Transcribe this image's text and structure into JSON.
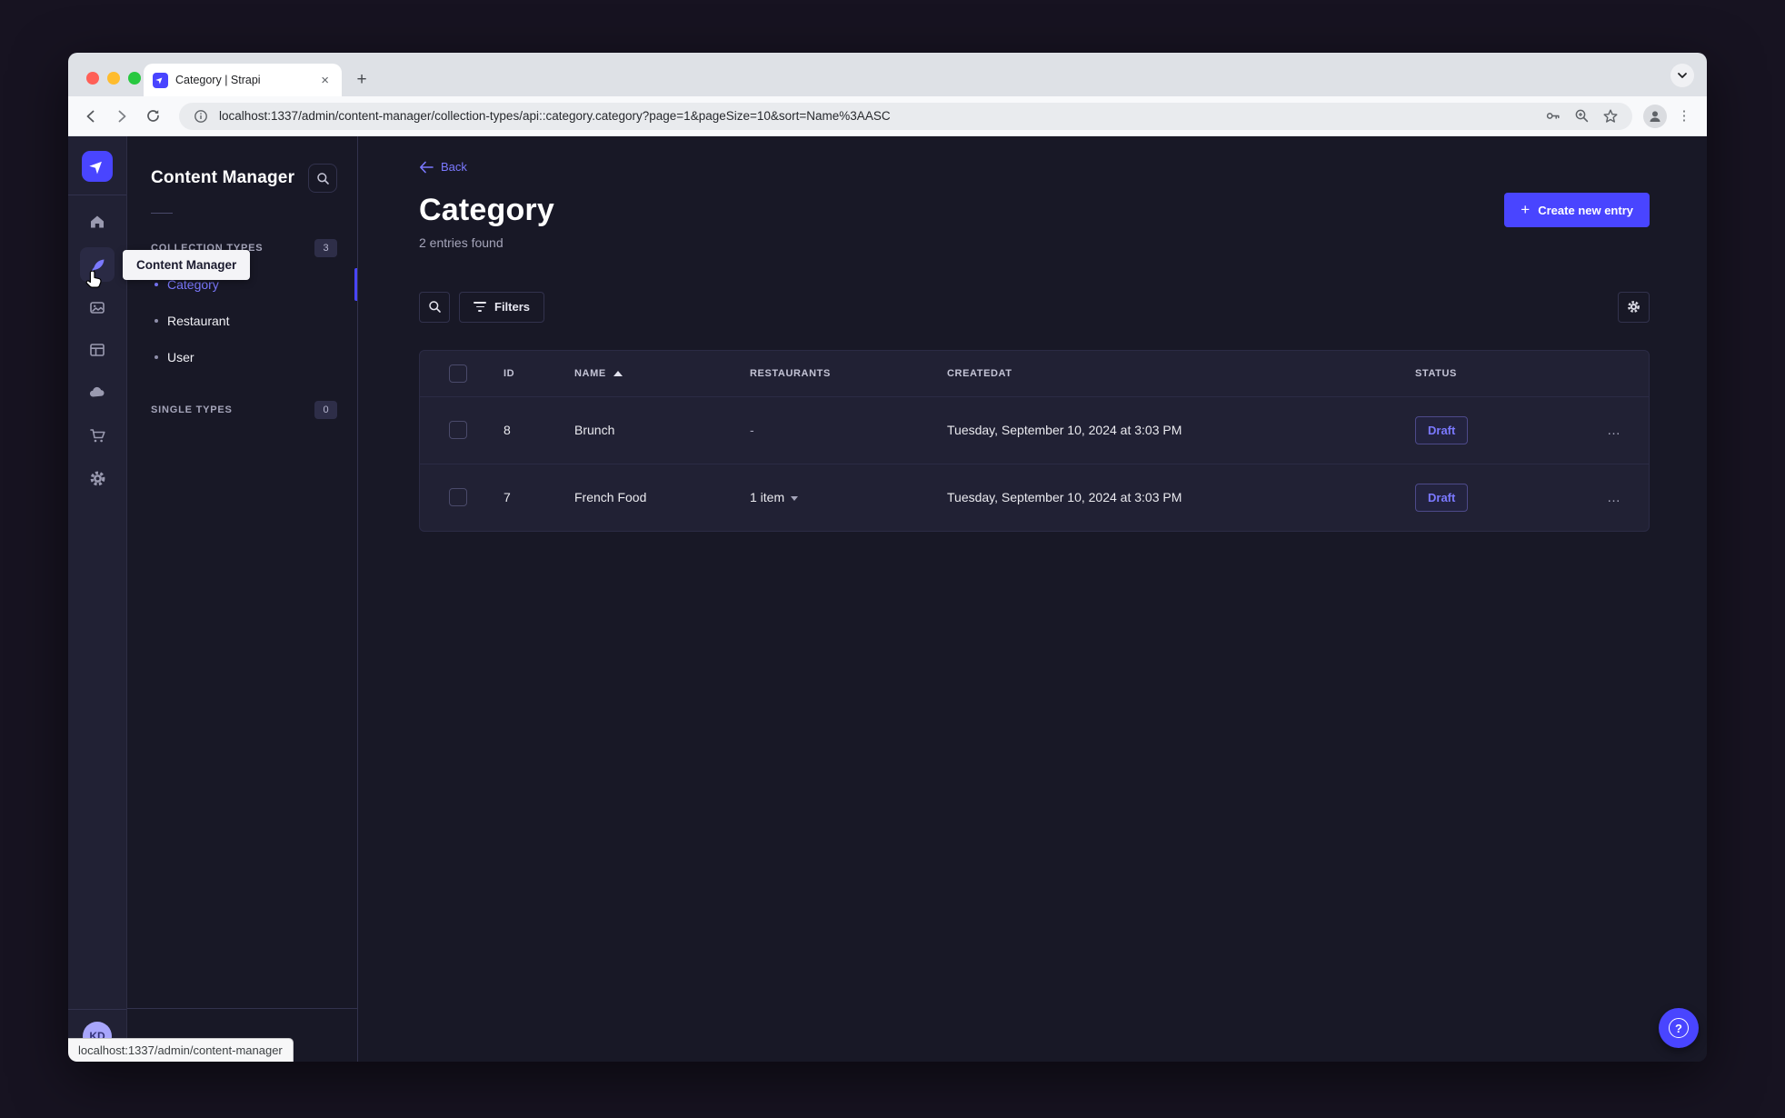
{
  "browser": {
    "tab_title": "Category | Strapi",
    "url": "localhost:1337/admin/content-manager/collection-types/api::category.category?page=1&pageSize=10&sort=Name%3AASC",
    "status_preview": "localhost:1337/admin/content-manager"
  },
  "nav": {
    "tooltip": "Content Manager",
    "user_initials": "KD"
  },
  "subnav": {
    "title": "Content Manager",
    "collection_types": {
      "label": "COLLECTION TYPES",
      "badge": "3",
      "items": [
        {
          "label": "Category"
        },
        {
          "label": "Restaurant"
        },
        {
          "label": "User"
        }
      ]
    },
    "single_types": {
      "label": "SINGLE TYPES",
      "badge": "0"
    }
  },
  "main": {
    "back": "Back",
    "title": "Category",
    "subtitle": "2 entries found",
    "create_button": "Create new entry",
    "filters_button": "Filters",
    "table": {
      "headers": {
        "id": "ID",
        "name": "NAME",
        "restaurants": "RESTAURANTS",
        "createdat": "CREATEDAT",
        "status": "STATUS"
      },
      "rows": [
        {
          "id": "8",
          "name": "Brunch",
          "restaurants": "-",
          "createdat": "Tuesday, September 10, 2024 at 3:03 PM",
          "status": "Draft"
        },
        {
          "id": "7",
          "name": "French Food",
          "restaurants": "1 item",
          "createdat": "Tuesday, September 10, 2024 at 3:03 PM",
          "status": "Draft"
        }
      ]
    }
  },
  "colors": {
    "primary": "#4945ff",
    "primary_light": "#7b79ff",
    "app_bg": "#181826",
    "card_bg": "#212134",
    "border": "#32324d"
  }
}
